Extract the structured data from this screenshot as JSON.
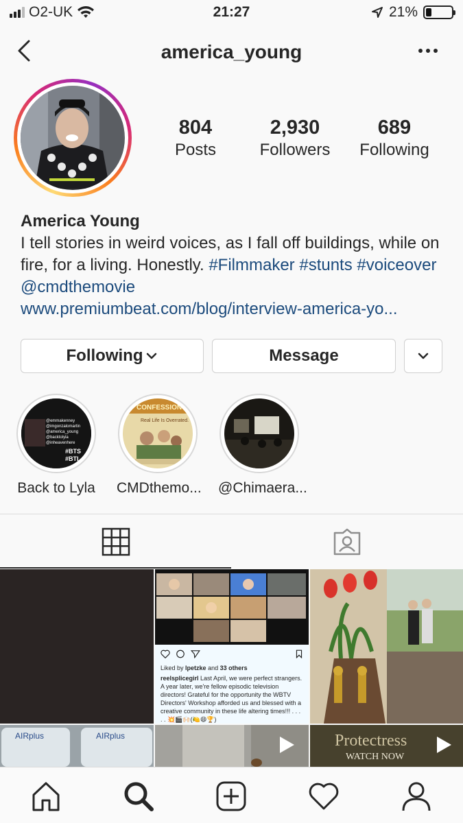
{
  "status_bar": {
    "carrier": "O2-UK",
    "time": "21:27",
    "battery": "21%",
    "battery_level": 0.21
  },
  "header": {
    "username": "america_young"
  },
  "profile": {
    "stats": [
      {
        "value": "804",
        "label": "Posts"
      },
      {
        "value": "2,930",
        "label": "Followers"
      },
      {
        "value": "689",
        "label": "Following"
      }
    ],
    "name": "America Young",
    "bio_text": "I tell stories in weird voices, as I fall off buildings, while on fire, for a living. Honestly.",
    "bio_hashtag1": "#Filmmaker",
    "bio_hashtag2": "#stunts",
    "bio_hashtag3": "#voiceover",
    "bio_mention": "@cmdthemovie",
    "website": "www.premiumbeat.com/blog/interview-america-yo..."
  },
  "buttons": {
    "following": "Following",
    "message": "Message"
  },
  "highlights": [
    {
      "label": "Back to Lyla",
      "overlay_lines": [
        "@emmakenney",
        "@imgonzalomartin",
        "@america_young",
        "@backtolyla",
        "@inheavenhere"
      ],
      "tags": "#BTS\n#BTL"
    },
    {
      "label": "CMDthemo...",
      "poster_text": "Real Life Is Overrated."
    },
    {
      "label": "@Chimaera..."
    }
  ],
  "grid_post": {
    "liked_by_prefix": "Liked by",
    "liked_user": "lpetzke",
    "liked_and": "and",
    "liked_others": "33 others",
    "caption_user": "reelsplicegirl",
    "caption_text": "Last April, we were perfect strangers.  A year later, we're fellow episodic television directors!  Grateful for the opportunity the WBTV Directors' Workshop afforded us and blessed with a creative community in these life altering times!!! . . . . . 💥🎬🙌🏻(🍋😄🏆)"
  },
  "grid_tiles": {
    "airplus_text": "AIRplus",
    "protectress_title": "Protectress",
    "protectress_sub": "WATCH NOW"
  },
  "colors": {
    "link": "#1b4a7c",
    "text": "#262626",
    "border": "#dbdbdb"
  }
}
